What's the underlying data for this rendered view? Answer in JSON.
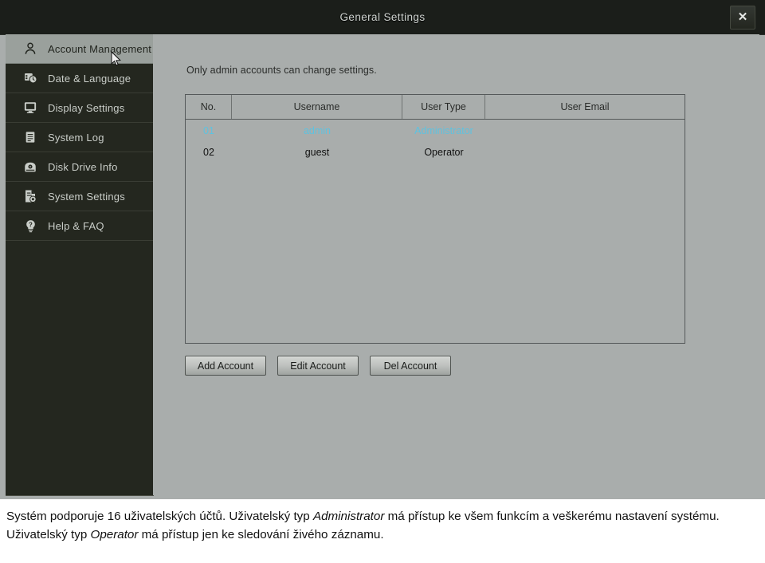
{
  "window": {
    "title": "General Settings",
    "close_label": "✕",
    "colors": {
      "titlebar_bg": "#1b1e1a",
      "sidebar_bg": "#24271f",
      "content_bg": "#a9adac",
      "selected_row_text": "#5ec2e0",
      "sidebar_selected_bg": "#9aa09c"
    }
  },
  "sidebar": {
    "items": [
      {
        "label": "Account Management",
        "icon": "user-icon",
        "selected": true
      },
      {
        "label": "Date & Language",
        "icon": "calendar-clock-icon",
        "selected": false
      },
      {
        "label": "Display Settings",
        "icon": "monitor-icon",
        "selected": false
      },
      {
        "label": "System Log",
        "icon": "document-list-icon",
        "selected": false
      },
      {
        "label": "Disk Drive Info",
        "icon": "disk-drive-icon",
        "selected": false
      },
      {
        "label": "System Settings",
        "icon": "document-gear-icon",
        "selected": false
      },
      {
        "label": "Help & FAQ",
        "icon": "question-bulb-icon",
        "selected": false
      }
    ]
  },
  "main": {
    "notice": "Only admin accounts can change settings.",
    "table": {
      "columns": [
        "No.",
        "Username",
        "User Type",
        "User Email"
      ],
      "rows": [
        {
          "no": "01",
          "username": "admin",
          "user_type": "Administrator",
          "user_email": "",
          "selected": true
        },
        {
          "no": "02",
          "username": "guest",
          "user_type": "Operator",
          "user_email": "",
          "selected": false
        }
      ]
    },
    "buttons": [
      {
        "label": "Add Account",
        "name": "add-account-button"
      },
      {
        "label": "Edit Account",
        "name": "edit-account-button"
      },
      {
        "label": "Del Account",
        "name": "del-account-button"
      }
    ]
  },
  "caption": {
    "part1": "Systém podporuje 16 uživatelských účtů. Uživatelský typ ",
    "em1": "Administrator",
    "part2": " má přístup ke všem funkcím a veškerému nastavení systému. Uživatelský typ ",
    "em2": "Operator",
    "part3": " má přístup jen ke sledování živého záznamu."
  }
}
